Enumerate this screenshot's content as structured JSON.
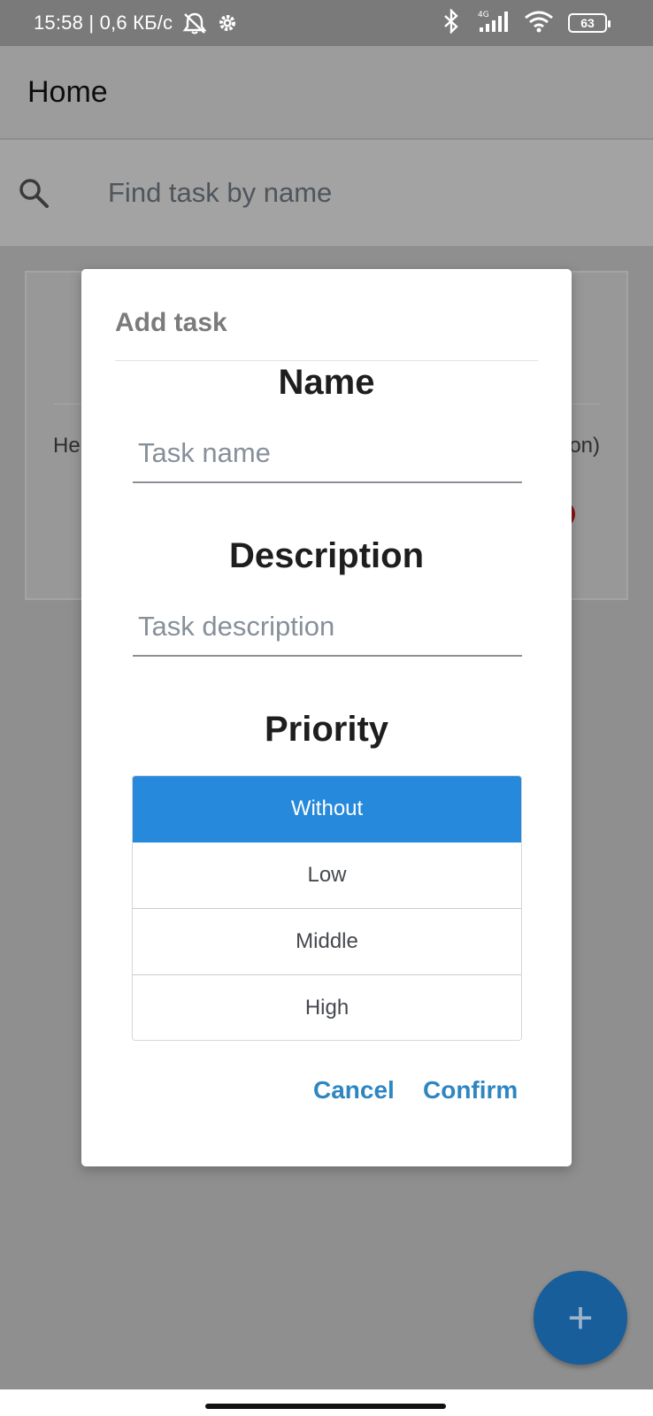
{
  "status_bar": {
    "time_and_speed": "15:58 | 0,6 КБ/с",
    "network": "4G",
    "battery": "63"
  },
  "app_bar": {
    "title": "Home"
  },
  "search": {
    "placeholder": "Find task by name"
  },
  "task_card": {
    "text_left": "He",
    "text_right": "on)"
  },
  "dialog": {
    "title": "Add task",
    "name_label": "Name",
    "name_placeholder": "Task name",
    "description_label": "Description",
    "description_placeholder": "Task description",
    "priority_label": "Priority",
    "priority_options": [
      "Without",
      "Low",
      "Middle",
      "High"
    ],
    "priority_selected": "Without",
    "cancel_label": "Cancel",
    "confirm_label": "Confirm"
  },
  "fab": {
    "label": "+"
  },
  "colors": {
    "accent": "#2689db",
    "button_text": "#2e86c1",
    "fab": "#175e9a"
  }
}
